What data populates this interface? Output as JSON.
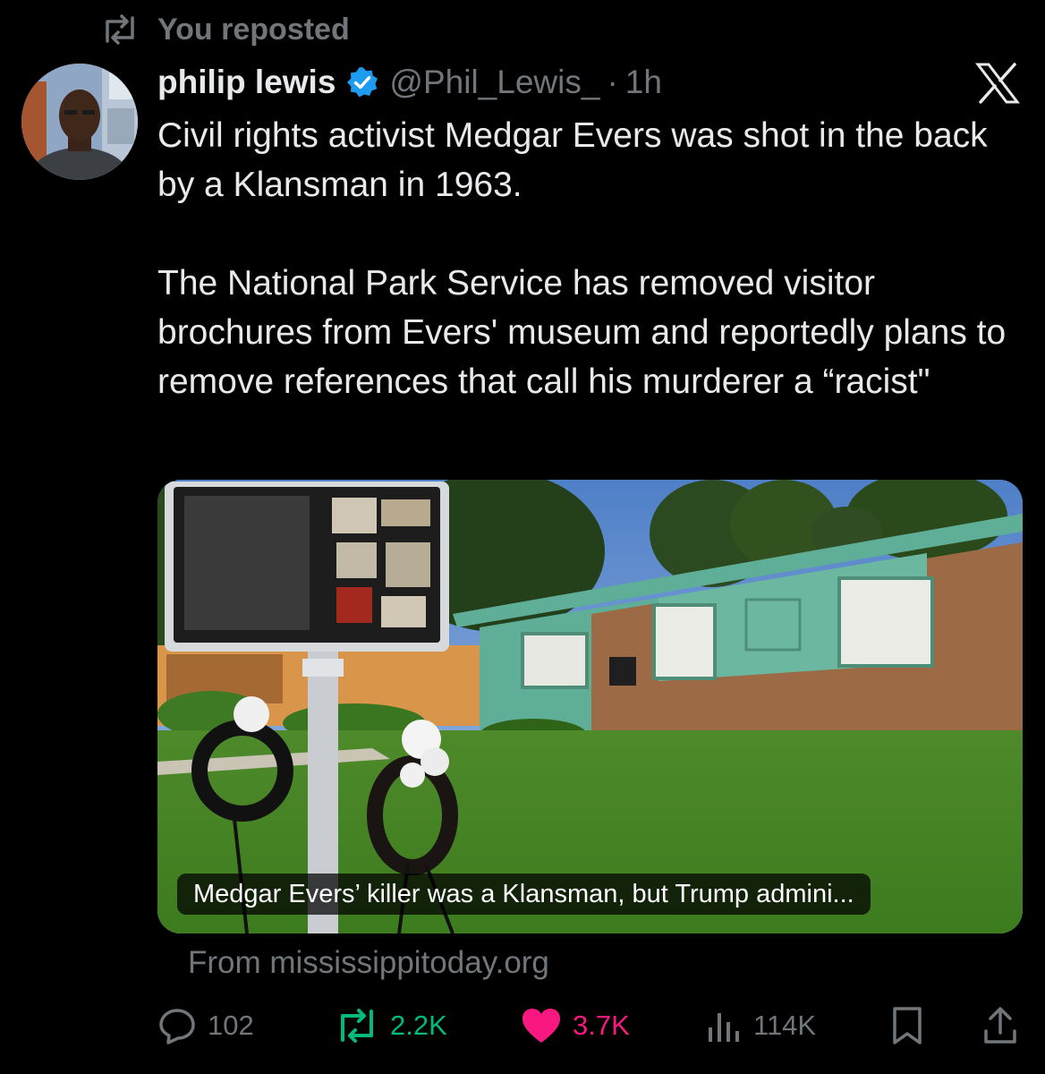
{
  "repost": {
    "label": "You reposted",
    "icon": "repost-icon"
  },
  "author": {
    "display_name": "philip lewis",
    "verified": true,
    "handle": "@Phil_Lewis_",
    "separator": "·",
    "time": "1h"
  },
  "tweet": {
    "paragraphs": [
      "Civil rights activist Medgar Evers was shot in the back by a Klansman in 1963.",
      "The National Park Service has removed visitor brochures from Evers' museum and reportedly plans to remove references that call his murderer a “racist\""
    ]
  },
  "card": {
    "caption": "Medgar Evers’ killer was a Klansman, but Trump admini...",
    "source": "From mississippitoday.org"
  },
  "actions": {
    "replies": "102",
    "reposts": "2.2K",
    "likes": "3.7K",
    "views": "114K"
  },
  "colors": {
    "background": "#000000",
    "text": "#e7e9ea",
    "muted": "#71767b",
    "verified": "#1d9bf0",
    "repost_active": "#00ba7c",
    "like_active": "#f91880"
  },
  "icons": [
    "repost-icon",
    "verified-badge-icon",
    "x-logo-icon",
    "reply-icon",
    "retweet-icon",
    "heart-icon",
    "views-icon",
    "bookmark-icon",
    "share-icon"
  ]
}
